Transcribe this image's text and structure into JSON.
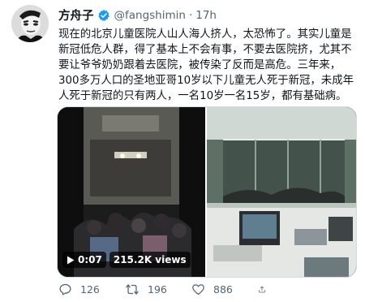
{
  "tweet": {
    "author_name": "方舟子",
    "handle": "@fangshimin",
    "separator": "·",
    "time": "17h",
    "text_lines": [
      "现在的北京儿童医院人山人海人挤人，太恐怖了。其实儿童是",
      "新冠低危人群，得了基本上不会有事，不要去医院挤，尤其不",
      "要让爷爷奶奶跟着去医院，被传染了反而是高危。三年来，",
      "300多万人口的圣地亚哥10岁以下儿童无人死于新冠，未成年",
      "人死于新冠的只有两人，一名10岁一名15岁，都有基础病。"
    ],
    "video": {
      "duration": "0:07",
      "views": "215.2K views"
    },
    "actions": {
      "replies": "126",
      "retweets": "196",
      "likes": "886"
    }
  },
  "colors": {
    "verified": "#1d9bf0",
    "secondary_text": "#536471",
    "border": "#cfd9de"
  }
}
